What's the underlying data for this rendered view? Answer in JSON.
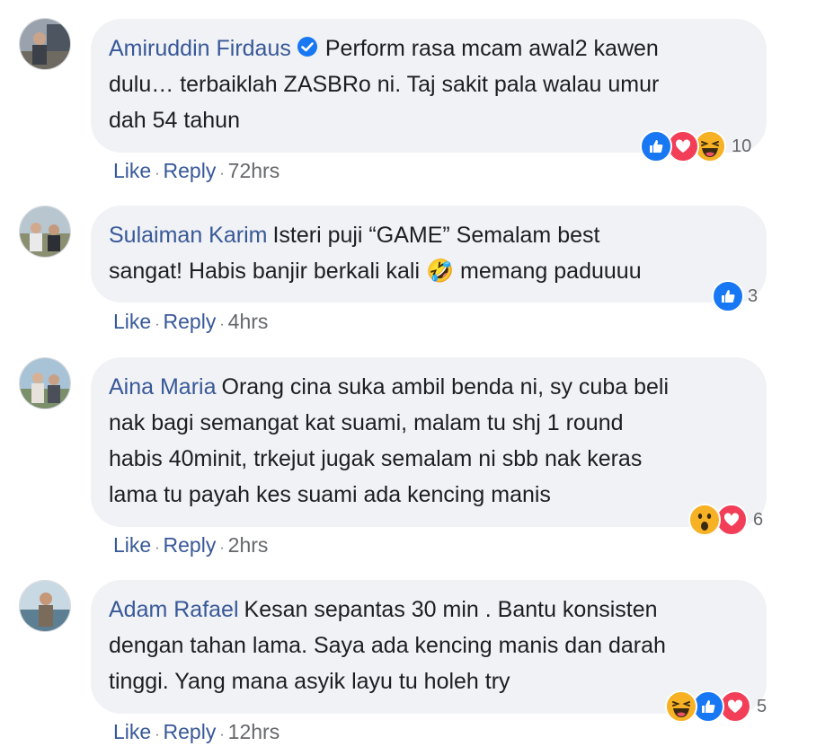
{
  "comments": [
    {
      "author": "Amiruddin Firdaus",
      "verified": true,
      "text": "Perform rasa mcam awal2 kawen\ndulu… terbaiklah ZASBRo ni. Taj sakit pala walau umur\ndah 54 tahun",
      "reactions": [
        "like-icon",
        "love-icon",
        "haha-icon"
      ],
      "reaction_count": "10",
      "like_label": "Like",
      "reply_label": "Reply",
      "time": "72hrs"
    },
    {
      "author": "Sulaiman Karim",
      "verified": false,
      "text_before": "Isteri puji “GAME” Semalam best\nsangat! Habis banjir berkali kali ",
      "emoji": "🤣",
      "text_after": " memang paduuuu",
      "reactions": [
        "like-icon"
      ],
      "reaction_count": "3",
      "like_label": "Like",
      "reply_label": "Reply",
      "time": "4hrs"
    },
    {
      "author": "Aina Maria",
      "verified": false,
      "text": "Orang cina suka ambil benda ni, sy cuba beli\nnak bagi semangat kat suami, malam tu shj 1 round\nhabis 40minit, trkejut jugak semalam ni sbb nak keras\nlama tu payah kes suami ada kencing manis",
      "reactions": [
        "wow-icon",
        "love-icon"
      ],
      "reaction_count": "6",
      "like_label": "Like",
      "reply_label": "Reply",
      "time": "2hrs"
    },
    {
      "author": "Adam Rafael",
      "verified": false,
      "text": "Kesan sepantas 30 min . Bantu konsisten\ndengan tahan lama. Saya ada kencing manis dan darah\ntinggi. Yang mana asyik layu tu holeh try",
      "reactions": [
        "haha-icon",
        "like-icon",
        "love-icon"
      ],
      "reaction_count": "5",
      "like_label": "Like",
      "reply_label": "Reply",
      "time": "12hrs"
    }
  ],
  "colors": {
    "author": "#385898",
    "bubble": "#f0f2f5",
    "meta": "#65676b",
    "like": "#1877f2",
    "love": "#f33e58",
    "haha": "#f7b125"
  }
}
